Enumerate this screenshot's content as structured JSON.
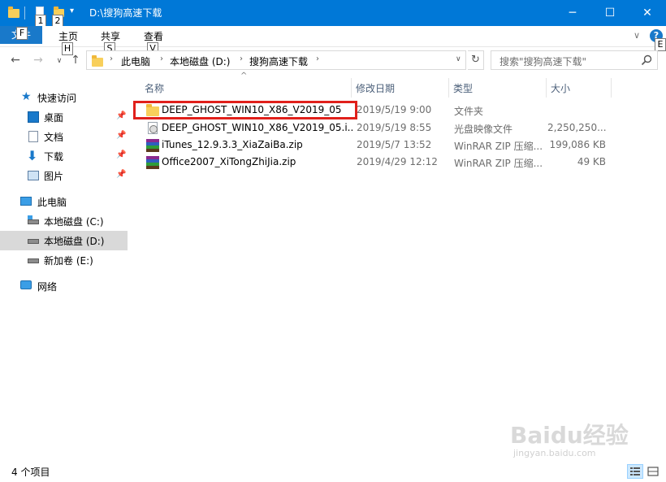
{
  "window": {
    "title": "D:\\搜狗高速下载",
    "minimize": "─",
    "maximize": "☐",
    "close": "✕"
  },
  "qat_keytips": [
    "1",
    "2"
  ],
  "ribbon": {
    "file_tab": "文件",
    "file_keytip": "F",
    "tabs": [
      {
        "label": "主页",
        "keytip": "H"
      },
      {
        "label": "共享",
        "keytip": "S"
      },
      {
        "label": "查看",
        "keytip": "V"
      }
    ],
    "help_keytip": "E"
  },
  "address": {
    "crumbs": [
      "此电脑",
      "本地磁盘 (D:)",
      "搜狗高速下载"
    ],
    "search_placeholder": "搜索\"搜狗高速下载\""
  },
  "nav": {
    "quick_access": "快速访问",
    "pinned": [
      "桌面",
      "文档",
      "下载",
      "图片"
    ],
    "this_pc": "此电脑",
    "drives": [
      "本地磁盘 (C:)",
      "本地磁盘 (D:)",
      "新加卷 (E:)"
    ],
    "network": "网络",
    "selected": "本地磁盘 (D:)"
  },
  "columns": {
    "name": "名称",
    "date": "修改日期",
    "type": "类型",
    "size": "大小"
  },
  "files": [
    {
      "name": "DEEP_GHOST_WIN10_X86_V2019_05",
      "date": "2019/5/19 9:00",
      "type": "文件夹",
      "size": "",
      "icon": "folder-icon"
    },
    {
      "name": "DEEP_GHOST_WIN10_X86_V2019_05.i...",
      "date": "2019/5/19 8:55",
      "type": "光盘映像文件",
      "size": "2,250,250...",
      "icon": "disc-image-icon"
    },
    {
      "name": "iTunes_12.9.3.3_XiaZaiBa.zip",
      "date": "2019/5/7 13:52",
      "type": "WinRAR ZIP 压缩...",
      "size": "199,086 KB",
      "icon": "winrar-icon"
    },
    {
      "name": "Office2007_XiTongZhiJia.zip",
      "date": "2019/4/29 12:12",
      "type": "WinRAR ZIP 压缩...",
      "size": "49 KB",
      "icon": "winrar-icon"
    }
  ],
  "status": {
    "item_count": "4 个项目"
  },
  "watermark": {
    "main": "Baidu经验",
    "sub": "jingyan.baidu.com"
  },
  "colors": {
    "titlebar": "#0078d7",
    "accent": "#1979ca",
    "selection": "#d9d9d9",
    "highlight_box": "#e0201b"
  }
}
